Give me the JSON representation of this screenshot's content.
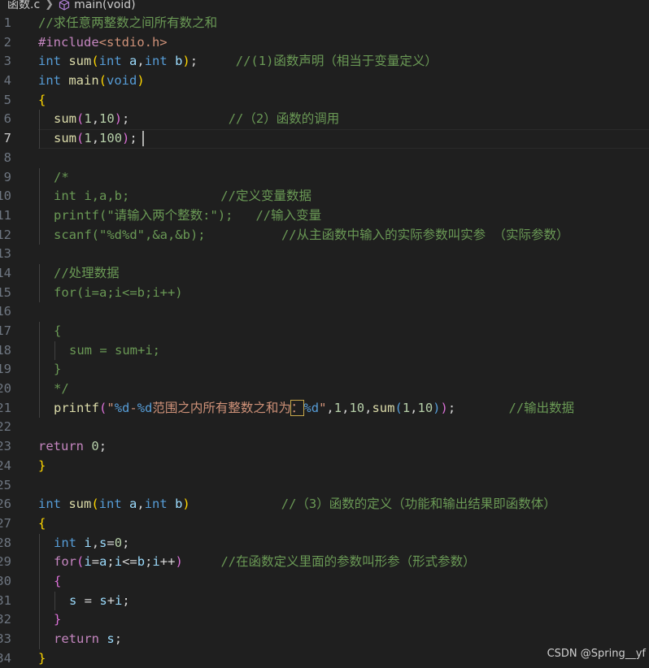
{
  "breadcrumb": {
    "file": "函数.c",
    "symbol": "main(void)",
    "file_icon": "chevron-right-icon",
    "symbol_icon": "cube-icon"
  },
  "editor": {
    "current_line": 7,
    "lines": [
      {
        "n": "1",
        "indent": 0,
        "tokens": [
          [
            "c",
            "//求任意两整数之间所有数之和"
          ]
        ]
      },
      {
        "n": "2",
        "indent": 0,
        "tokens": [
          [
            "pre",
            "#include"
          ],
          [
            "inc",
            "<stdio.h>"
          ]
        ]
      },
      {
        "n": "3",
        "indent": 0,
        "tokens": [
          [
            "kw",
            "int"
          ],
          [
            "p",
            " "
          ],
          [
            "fn",
            "sum"
          ],
          [
            "b",
            "("
          ],
          [
            "kw",
            "int"
          ],
          [
            "p",
            " "
          ],
          [
            "pa",
            "a"
          ],
          [
            "p",
            ","
          ],
          [
            "kw",
            "int"
          ],
          [
            "p",
            " "
          ],
          [
            "pa",
            "b"
          ],
          [
            "b",
            ")"
          ],
          [
            "p",
            ";     "
          ],
          [
            "c",
            "//(1)函数声明（相当于变量定义）"
          ]
        ]
      },
      {
        "n": "4",
        "indent": 0,
        "tokens": [
          [
            "kw",
            "int"
          ],
          [
            "p",
            " "
          ],
          [
            "fn",
            "main"
          ],
          [
            "b",
            "("
          ],
          [
            "kw",
            "void"
          ],
          [
            "b",
            ")"
          ]
        ]
      },
      {
        "n": "5",
        "indent": 0,
        "tokens": [
          [
            "b",
            "{"
          ]
        ]
      },
      {
        "n": "6",
        "indent": 1,
        "tokens": [
          [
            "fn",
            "sum"
          ],
          [
            "b2",
            "("
          ],
          [
            "num",
            "1"
          ],
          [
            "p",
            ","
          ],
          [
            "num",
            "10"
          ],
          [
            "b2",
            ")"
          ],
          [
            "p",
            ";             "
          ],
          [
            "c",
            "//（2）函数的调用"
          ]
        ]
      },
      {
        "n": "7",
        "indent": 1,
        "tokens": [
          [
            "fn",
            "sum"
          ],
          [
            "b2",
            "("
          ],
          [
            "num",
            "1"
          ],
          [
            "p",
            ","
          ],
          [
            "num",
            "100"
          ],
          [
            "b2",
            ")"
          ],
          [
            "p",
            ";"
          ]
        ],
        "cursor": true
      },
      {
        "n": "8",
        "indent": 0,
        "tokens": []
      },
      {
        "n": "9",
        "indent": 1,
        "tokens": [
          [
            "c",
            "/*"
          ]
        ]
      },
      {
        "n": "10",
        "indent": 1,
        "tokens": [
          [
            "c",
            "int i,a,b;            //定义变量数据"
          ]
        ]
      },
      {
        "n": "11",
        "indent": 1,
        "tokens": [
          [
            "c",
            "printf(\"请输入两个整数:\");   //输入变量"
          ]
        ]
      },
      {
        "n": "12",
        "indent": 1,
        "tokens": [
          [
            "c",
            "scanf(\"%d%d\",&a,&b);          //从主函数中输入的实际参数叫实参 （实际参数）"
          ]
        ]
      },
      {
        "n": "13",
        "indent": 0,
        "tokens": []
      },
      {
        "n": "14",
        "indent": 1,
        "tokens": [
          [
            "c",
            "//处理数据"
          ]
        ]
      },
      {
        "n": "15",
        "indent": 1,
        "tokens": [
          [
            "c",
            "for(i=a;i<=b;i++)"
          ]
        ]
      },
      {
        "n": "16",
        "indent": 0,
        "tokens": []
      },
      {
        "n": "17",
        "indent": 1,
        "tokens": [
          [
            "c",
            "{"
          ]
        ]
      },
      {
        "n": "18",
        "indent": 2,
        "tokens": [
          [
            "c",
            "sum = sum+i;"
          ]
        ]
      },
      {
        "n": "19",
        "indent": 1,
        "tokens": [
          [
            "c",
            "}"
          ]
        ]
      },
      {
        "n": "20",
        "indent": 1,
        "tokens": [
          [
            "c",
            "*/"
          ]
        ]
      },
      {
        "n": "21",
        "indent": 1,
        "tokens": [
          [
            "fn",
            "printf"
          ],
          [
            "b2",
            "("
          ],
          [
            "s",
            "\""
          ],
          [
            "f",
            "%d"
          ],
          [
            "s",
            "-"
          ],
          [
            "f",
            "%d"
          ],
          [
            "s",
            "范围之内所有整数之和为"
          ],
          [
            "sel",
            "："
          ],
          [
            "f",
            "%d"
          ],
          [
            "s",
            "\""
          ],
          [
            "p",
            ","
          ],
          [
            "num",
            "1"
          ],
          [
            "p",
            ","
          ],
          [
            "num",
            "10"
          ],
          [
            "p",
            ","
          ],
          [
            "fn",
            "sum"
          ],
          [
            "b3",
            "("
          ],
          [
            "num",
            "1"
          ],
          [
            "p",
            ","
          ],
          [
            "num",
            "10"
          ],
          [
            "b3",
            ")"
          ],
          [
            "b2",
            ")"
          ],
          [
            "p",
            ";       "
          ],
          [
            "c",
            "//输出数据"
          ]
        ]
      },
      {
        "n": "22",
        "indent": 0,
        "tokens": []
      },
      {
        "n": "23",
        "indent": 0,
        "tokens": [
          [
            "ctrl",
            "return"
          ],
          [
            "p",
            " "
          ],
          [
            "num",
            "0"
          ],
          [
            "p",
            ";"
          ]
        ]
      },
      {
        "n": "24",
        "indent": 0,
        "tokens": [
          [
            "b",
            "}"
          ]
        ]
      },
      {
        "n": "25",
        "indent": 0,
        "tokens": []
      },
      {
        "n": "26",
        "indent": 0,
        "tokens": [
          [
            "kw",
            "int"
          ],
          [
            "p",
            " "
          ],
          [
            "fn",
            "sum"
          ],
          [
            "b",
            "("
          ],
          [
            "kw",
            "int"
          ],
          [
            "p",
            " "
          ],
          [
            "pa",
            "a"
          ],
          [
            "p",
            ","
          ],
          [
            "kw",
            "int"
          ],
          [
            "p",
            " "
          ],
          [
            "pa",
            "b"
          ],
          [
            "b",
            ")"
          ],
          [
            "p",
            "            "
          ],
          [
            "c",
            "//（3）函数的定义（功能和输出结果即函数体）"
          ]
        ]
      },
      {
        "n": "27",
        "indent": 0,
        "tokens": [
          [
            "b",
            "{"
          ]
        ]
      },
      {
        "n": "28",
        "indent": 1,
        "tokens": [
          [
            "kw",
            "int"
          ],
          [
            "p",
            " "
          ],
          [
            "pa",
            "i"
          ],
          [
            "p",
            ","
          ],
          [
            "pa",
            "s"
          ],
          [
            "p",
            "="
          ],
          [
            "num",
            "0"
          ],
          [
            "p",
            ";"
          ]
        ]
      },
      {
        "n": "29",
        "indent": 1,
        "tokens": [
          [
            "ctrl",
            "for"
          ],
          [
            "b2",
            "("
          ],
          [
            "pa",
            "i"
          ],
          [
            "p",
            "="
          ],
          [
            "pa",
            "a"
          ],
          [
            "p",
            ";"
          ],
          [
            "pa",
            "i"
          ],
          [
            "p",
            "<="
          ],
          [
            "pa",
            "b"
          ],
          [
            "p",
            ";"
          ],
          [
            "pa",
            "i"
          ],
          [
            "p",
            "++"
          ],
          [
            "b2",
            ")"
          ],
          [
            "p",
            "     "
          ],
          [
            "c",
            "//在函数定义里面的参数叫形参（形式参数）"
          ]
        ]
      },
      {
        "n": "30",
        "indent": 1,
        "tokens": [
          [
            "b2",
            "{"
          ]
        ]
      },
      {
        "n": "31",
        "indent": 2,
        "tokens": [
          [
            "pa",
            "s"
          ],
          [
            "p",
            " = "
          ],
          [
            "pa",
            "s"
          ],
          [
            "p",
            "+"
          ],
          [
            "pa",
            "i"
          ],
          [
            "p",
            ";"
          ]
        ]
      },
      {
        "n": "32",
        "indent": 1,
        "tokens": [
          [
            "b2",
            "}"
          ]
        ]
      },
      {
        "n": "33",
        "indent": 1,
        "tokens": [
          [
            "ctrl",
            "return"
          ],
          [
            "p",
            " "
          ],
          [
            "pa",
            "s"
          ],
          [
            "p",
            ";"
          ]
        ]
      },
      {
        "n": "34",
        "indent": 0,
        "tokens": [
          [
            "b",
            "}"
          ]
        ]
      }
    ]
  },
  "watermark": "CSDN @Spring__yf"
}
